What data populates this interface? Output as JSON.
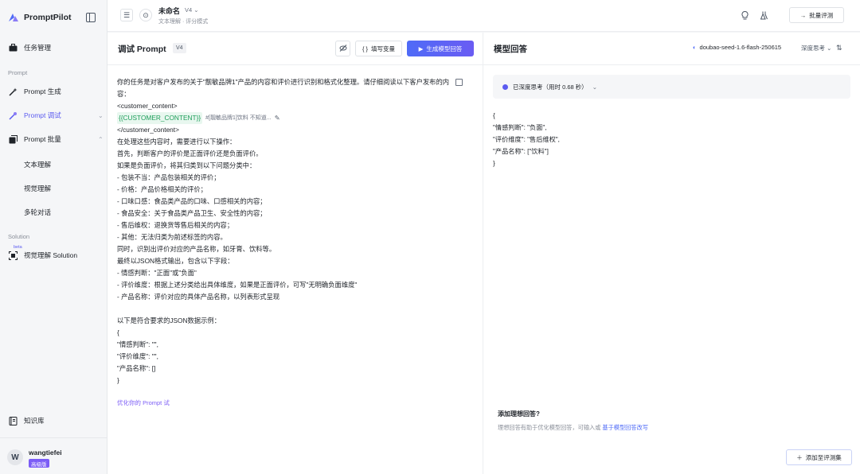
{
  "sidebar": {
    "brand": "PromptPilot",
    "task_manage": "任务管理",
    "section_prompt": "Prompt",
    "prompt_generate": "Prompt 生成",
    "prompt_debug": "Prompt 调试",
    "prompt_batch": "Prompt 批量",
    "sub_text": "文本理解",
    "sub_vision": "视觉理解",
    "sub_multi": "多轮对话",
    "section_solution": "Solution",
    "beta": "beta",
    "vision_solution": "视觉理解 Solution",
    "knowledge": "知识库",
    "user": {
      "name": "wangtiefei",
      "avatar_letter": "W",
      "tier": "高级版"
    }
  },
  "topbar": {
    "title": "未命名",
    "version": "V4",
    "subtitle": "文本理解 · 评分模式",
    "batch_eval": "批量评测"
  },
  "editor": {
    "title": "调试 Prompt",
    "version": "V4",
    "fill_vars": "填写变量",
    "generate": "生成模型回答",
    "lines": [
      "你的任务是对客户发布的关于\"靓敏品牌1\"产品的内容和评价进行识别和格式化整理。请仔细阅读以下客户发布的内",
      "容：",
      "<customer_content>",
      "__VAR__",
      "</customer_content>",
      "在处理这些内容时，需要进行以下操作：",
      "首先，判断客户的评价是正面评价还是负面评价。",
      "如果是负面评价，将其归类到以下问题分类中：",
      "- 包装不当：产品包装相关的评价；",
      "- 价格：产品价格相关的评价；",
      "- 口味口感：食品类产品的口味、口感相关的内容；",
      "- 食品安全：关于食品类产品卫生、安全性的内容；",
      "- 售后维权：退换货等售后相关的内容；",
      "- 其他：无法归类为前述标签的内容。",
      "同时，识别出评价对应的产品名称，如牙膏、饮料等。",
      "最终以JSON格式输出，包含以下字段：",
      "- 情感判断：\"正面\"或\"负面\"",
      "- 评价维度：根据上述分类给出具体维度，如果是正面评价，可写\"无明确负面维度\"",
      "- 产品名称：评价对应的具体产品名称，以列表形式呈现",
      "",
      "以下是符合要求的JSON数据示例：",
      "{",
      "\"情感判断\": \"\",",
      "\"评价维度\": \"\",",
      "\"产品名称\": []",
      "}"
    ],
    "var_name": "{{CUSTOMER_CONTENT}}",
    "var_hint": "#[靓敏品牌1]饮料 不知道...",
    "optimize": "优化你的 Prompt 试"
  },
  "answer": {
    "title": "模型回答",
    "model": "doubao-seed-1.6-flash-250615",
    "think_mode": "深度思考",
    "think_status": "已深度思考（用时 0.68 秒）",
    "json_lines": [
      "{",
      "\"情感判断\": \"负面\",",
      "\"评价维度\": \"售后维权\",",
      "\"产品名称\": [\"饮料\"]",
      "}"
    ],
    "ideal_title": "添加理想回答?",
    "ideal_hint": "理想回答有助于优化模型回答，可输入或",
    "ideal_link": "基于模型回答改写",
    "add_eval_set": "添加至评测集"
  },
  "colors": {
    "accent": "#5b5bf0",
    "primary_btn": "#4f6bf7",
    "var_green": "#1e9e5a",
    "badge_purple": "#7b5cf6"
  }
}
